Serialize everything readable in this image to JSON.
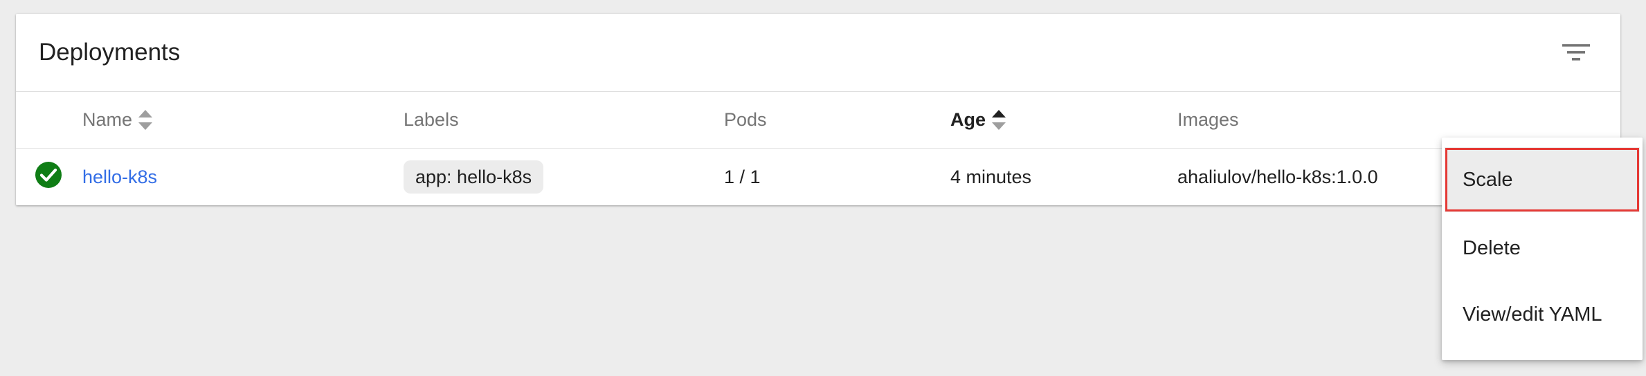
{
  "card": {
    "title": "Deployments",
    "filter_icon": "filter-list-icon"
  },
  "table": {
    "columns": [
      {
        "label": "Name",
        "sortable": true,
        "active": false
      },
      {
        "label": "Labels",
        "sortable": false,
        "active": false
      },
      {
        "label": "Pods",
        "sortable": false,
        "active": false
      },
      {
        "label": "Age",
        "sortable": true,
        "active": true
      },
      {
        "label": "Images",
        "sortable": false,
        "active": false
      }
    ],
    "rows": [
      {
        "status_icon": "check-circle-icon",
        "status_color": "#0f7d15",
        "name": "hello-k8s",
        "labels": [
          "app: hello-k8s"
        ],
        "pods": "1 / 1",
        "age": "4 minutes",
        "images": "ahaliulov/hello-k8s:1.0.0"
      }
    ]
  },
  "context_menu": {
    "items": [
      {
        "label": "Scale",
        "highlighted": true
      },
      {
        "label": "Delete",
        "highlighted": false
      },
      {
        "label": "View/edit YAML",
        "highlighted": false
      }
    ]
  },
  "colors": {
    "page_background": "#ededed",
    "link": "#326de6",
    "success": "#0f7d15",
    "highlight_border": "#e53935"
  }
}
